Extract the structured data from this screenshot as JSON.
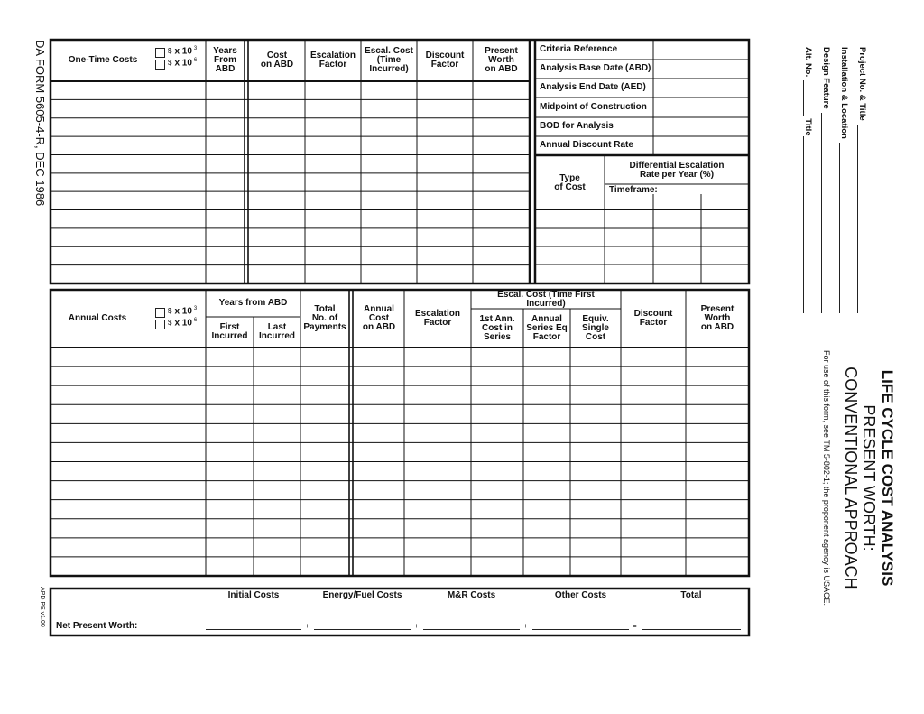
{
  "form_id": "DA FORM 5605-4-R, DEC 1986",
  "version": "APD PE v1.00",
  "title": {
    "line1": "LIFE CYCLE COST ANALYSIS",
    "line2": "PRESENT WORTH:",
    "line3": "CONVENTIONAL APPROACH",
    "note": "For use of this form, see TM 5-802-1; the proponent agency is USACE."
  },
  "project_fields": {
    "project": "Project No. & Title",
    "installation": "Installation & Location",
    "design_feature": "Design Feature",
    "alt_no": "Alt. No.",
    "alt_title": "Title"
  },
  "units": {
    "dollar": "$",
    "x10": "x 10",
    "thousand_exp": "3",
    "million_exp": "6"
  },
  "one_time": {
    "label": "One-Time Costs",
    "headers": [
      "Years\nFrom\nABD",
      "Cost\non ABD",
      "Escalation\nFactor",
      "Escal. Cost\n(Time\nIncurred)",
      "Discount\nFactor",
      "Present\nWorth\non ABD"
    ]
  },
  "criteria": {
    "rows": [
      "Criteria Reference",
      "Analysis Base Date (ABD)",
      "Analysis End Date (AED)",
      "Midpoint of Construction",
      "BOD for Analysis",
      "Annual Discount Rate"
    ],
    "type_of_cost": "Type\nof Cost",
    "diff_escalation": "Differential Escalation\nRate per Year (%)",
    "timeframe": "Timeframe:"
  },
  "annual": {
    "label": "Annual Costs",
    "years_from_abd": "Years from ABD",
    "first_incurred": "First\nIncurred",
    "last_incurred": "Last\nIncurred",
    "total_payments": "Total\nNo. of\nPayments",
    "annual_cost": "Annual\nCost\non ABD",
    "escalation_factor": "Escalation\nFactor",
    "escal_cost_group": "Escal. Cost (Time First\nIncurred)",
    "first_ann_cost": "1st Ann.\nCost in\nSeries",
    "annual_series": "Annual\nSeries Eq\nFactor",
    "equiv_single": "Equiv.\nSingle\nCost",
    "discount_factor": "Discount\nFactor",
    "present_worth": "Present\nWorth\non ABD"
  },
  "npw": {
    "label": "Net Present Worth:",
    "columns": [
      "Initial Costs",
      "Energy/Fuel Costs",
      "M&R Costs",
      "Other Costs",
      "Total"
    ],
    "operators": [
      "+",
      "+",
      "+",
      "="
    ]
  }
}
